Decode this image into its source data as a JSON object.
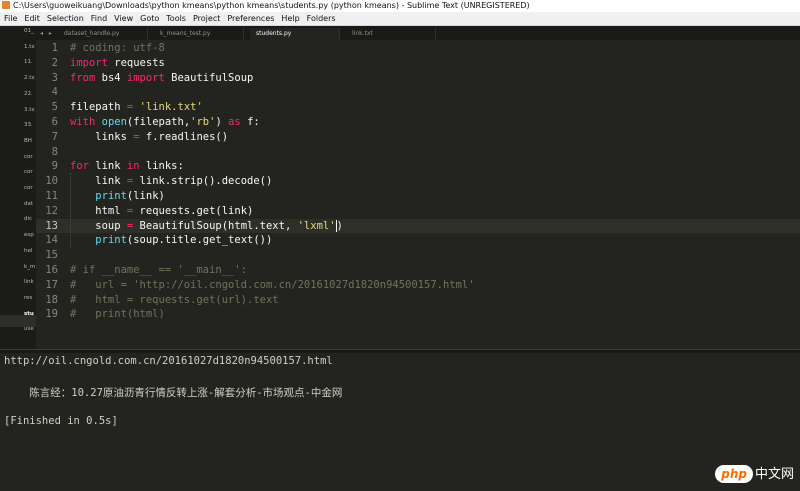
{
  "window": {
    "title": "C:\\Users\\guoweikuang\\Downloads\\python kmeans\\python kmeans\\students.py (python kmeans) - Sublime Text (UNREGISTERED)"
  },
  "menu": [
    "File",
    "Edit",
    "Selection",
    "Find",
    "View",
    "Goto",
    "Tools",
    "Project",
    "Preferences",
    "Help",
    "Folders"
  ],
  "sidebar": {
    "items": [
      "01_",
      "1.tx",
      "11.",
      "2.tx",
      "22.",
      "3.tx",
      "33.",
      "BH",
      "cor",
      "cor",
      "cor",
      "dat",
      "dic",
      "esp",
      "hel",
      "k_m",
      "link",
      "res",
      "stu",
      "use"
    ],
    "active_index": 18
  },
  "tabs": {
    "arrows": "◂ ▸",
    "items": [
      {
        "label": "dataset_handle.py",
        "active": false
      },
      {
        "label": "k_means_test.py",
        "active": false
      },
      {
        "label": "students.py",
        "active": true
      },
      {
        "label": "link.txt",
        "active": false
      }
    ]
  },
  "editor": {
    "current_line": 13,
    "lines": [
      {
        "n": "1",
        "code": "# coding: utf-8"
      },
      {
        "n": "2",
        "code": "import requests"
      },
      {
        "n": "3",
        "code": "from bs4 import BeautifulSoup"
      },
      {
        "n": "4",
        "code": ""
      },
      {
        "n": "5",
        "code": "filepath = 'link.txt'"
      },
      {
        "n": "6",
        "code": "with open(filepath,'rb') as f:"
      },
      {
        "n": "7",
        "code": "    links = f.readlines()"
      },
      {
        "n": "8",
        "code": ""
      },
      {
        "n": "9",
        "code": "for link in links:"
      },
      {
        "n": "10",
        "code": "    link = link.strip().decode()"
      },
      {
        "n": "11",
        "code": "    print(link)"
      },
      {
        "n": "12",
        "code": "    html = requests.get(link)"
      },
      {
        "n": "13",
        "code": "    soup = BeautifulSoup(html.text, 'lxml')"
      },
      {
        "n": "14",
        "code": "    print(soup.title.get_text())"
      },
      {
        "n": "15",
        "code": ""
      },
      {
        "n": "16",
        "code": "# if __name__ == '__main__':"
      },
      {
        "n": "17",
        "code": "#   url = 'http://oil.cngold.com.cn/20161027d1820n94500157.html'"
      },
      {
        "n": "18",
        "code": "#   html = requests.get(url).text"
      },
      {
        "n": "19",
        "code": "#   print(html)"
      }
    ]
  },
  "console": {
    "lines": [
      "http://oil.cngold.com.cn/20161027d1820n94500157.html",
      "    陈言经：10.27原油沥青行情反转上涨-解套分析-市场观点-中金网",
      "[Finished in 0.5s]"
    ]
  },
  "watermark": {
    "logo": "php",
    "text": "中文网"
  },
  "colors": {
    "background": "#23241f",
    "keyword": "#f92672",
    "string": "#e6db74",
    "comment": "#75715e",
    "function": "#66d9ef",
    "text": "#f8f8f2"
  }
}
